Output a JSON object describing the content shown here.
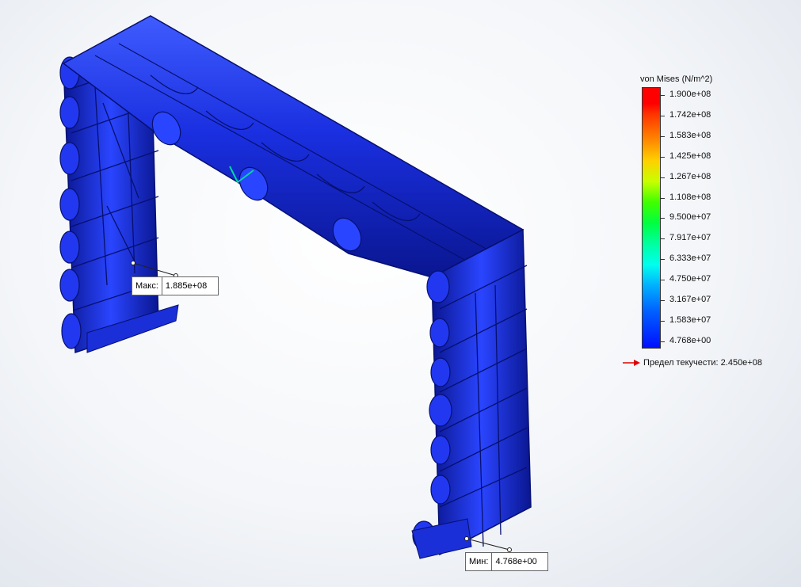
{
  "legend": {
    "title": "von Mises (N/m^2)",
    "ticks": [
      "1.900e+08",
      "1.742e+08",
      "1.583e+08",
      "1.425e+08",
      "1.267e+08",
      "1.108e+08",
      "9.500e+07",
      "7.917e+07",
      "6.333e+07",
      "4.750e+07",
      "3.167e+07",
      "1.583e+07",
      "4.768e+00"
    ],
    "yield_label": "Предел текучести: 2.450e+08",
    "colors": {
      "max": "#ff0000",
      "min": "#0010ff",
      "arrow": "#e00000"
    }
  },
  "probes": {
    "max": {
      "label": "Макс:",
      "value": "1.885e+08"
    },
    "min": {
      "label": "Мин:",
      "value": "4.768e+00"
    }
  }
}
